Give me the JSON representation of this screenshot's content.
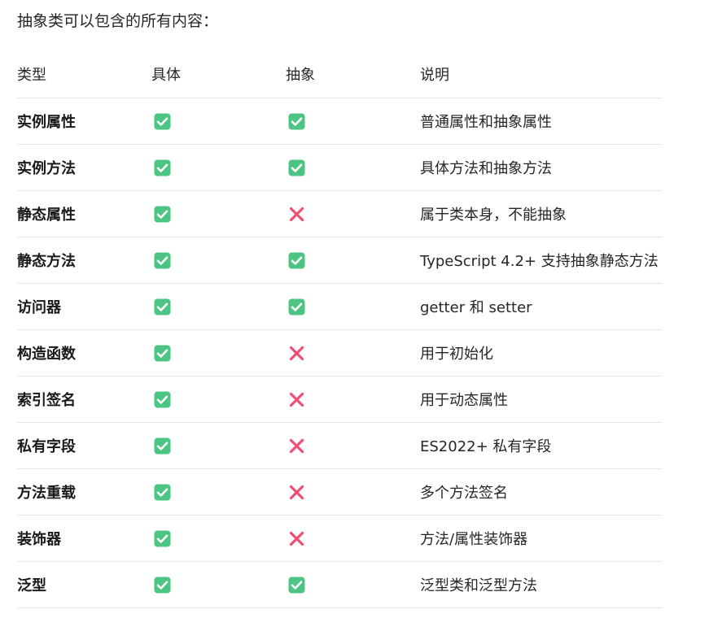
{
  "intro": "抽象类可以包含的所有内容：",
  "table": {
    "headers": [
      "类型",
      "具体",
      "抽象",
      "说明"
    ],
    "rows": [
      {
        "name": "实例属性",
        "concrete": "check",
        "abstract": "check",
        "note": "普通属性和抽象属性"
      },
      {
        "name": "实例方法",
        "concrete": "check",
        "abstract": "check",
        "note": "具体方法和抽象方法"
      },
      {
        "name": "静态属性",
        "concrete": "check",
        "abstract": "cross",
        "note": "属于类本身，不能抽象"
      },
      {
        "name": "静态方法",
        "concrete": "check",
        "abstract": "check",
        "note": "TypeScript 4.2+ 支持抽象静态方法"
      },
      {
        "name": "访问器",
        "concrete": "check",
        "abstract": "check",
        "note": "getter 和 setter"
      },
      {
        "name": "构造函数",
        "concrete": "check",
        "abstract": "cross",
        "note": "用于初始化"
      },
      {
        "name": "索引签名",
        "concrete": "check",
        "abstract": "cross",
        "note": "用于动态属性"
      },
      {
        "name": "私有字段",
        "concrete": "check",
        "abstract": "cross",
        "note": "ES2022+ 私有字段"
      },
      {
        "name": "方法重载",
        "concrete": "check",
        "abstract": "cross",
        "note": "多个方法签名"
      },
      {
        "name": "装饰器",
        "concrete": "check",
        "abstract": "cross",
        "note": "方法/属性装饰器"
      },
      {
        "name": "泛型",
        "concrete": "check",
        "abstract": "check",
        "note": "泛型类和泛型方法"
      }
    ]
  },
  "icons": {
    "check": {
      "name": "check-mark-icon",
      "color": "#4cc584"
    },
    "cross": {
      "name": "cross-mark-icon",
      "color": "#ef4f72"
    }
  }
}
